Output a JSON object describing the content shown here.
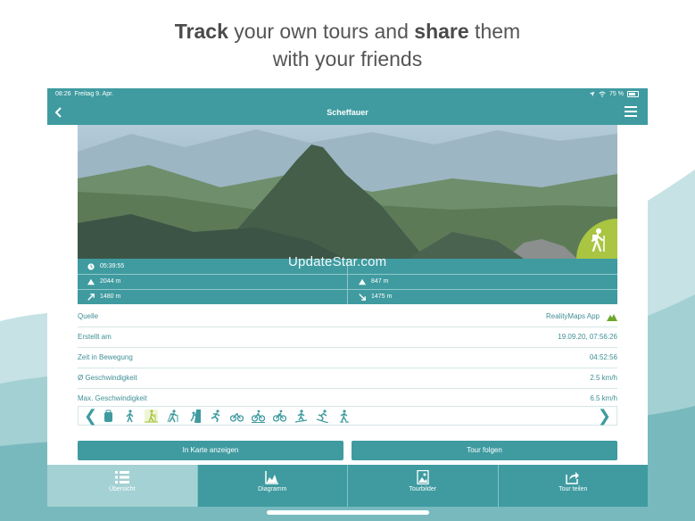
{
  "headline": {
    "part1": "Track",
    "part2": " your own tours and ",
    "part3": "share",
    "part4": " them",
    "part5": "with your friends"
  },
  "status_bar": {
    "time": "08:26",
    "date": "Freitag 9. Apr.",
    "battery": "75 %"
  },
  "nav": {
    "title": "Scheffauer",
    "back_icon": "chevron-left-icon",
    "menu_icon": "hamburger-menu-icon"
  },
  "photo": {
    "badge_icon": "hiker-icon"
  },
  "stats": {
    "row1": {
      "left": "05:39:55",
      "right": ""
    },
    "row2": {
      "left": "2044 m",
      "right": "847 m"
    },
    "row3": {
      "left": "1480 m",
      "right": "1475 m"
    }
  },
  "watermark": "UpdateStar.com",
  "info": [
    {
      "label": "Quelle",
      "value": "RealityMaps App"
    },
    {
      "label": "Erstellt am",
      "value": "19.09.20, 07:56:26"
    },
    {
      "label": "Zeit in Bewegung",
      "value": "04:52:56"
    },
    {
      "label": "Ø Geschwindigkeit",
      "value": "2.5 km/h"
    },
    {
      "label": "Max. Geschwindigkeit",
      "value": "6.5 km/h"
    }
  ],
  "activities": {
    "prev": "❮",
    "next": "❯",
    "icons": [
      "backpack-icon",
      "walking-icon",
      "hiking-icon",
      "nordic-walking-icon",
      "climbing-icon",
      "running-icon",
      "cycling-icon",
      "mountain-bike-icon",
      "ebike-icon",
      "ski-touring-icon",
      "skiing-icon",
      "snowshoe-icon"
    ]
  },
  "buttons": {
    "map": "In Karte anzeigen",
    "follow": "Tour folgen"
  },
  "tabs": [
    {
      "label": "Übersicht",
      "icon": "list-icon"
    },
    {
      "label": "Diagramm",
      "icon": "chart-icon"
    },
    {
      "label": "Tourbilder",
      "icon": "image-icon"
    },
    {
      "label": "Tour teilen",
      "icon": "share-icon"
    }
  ],
  "colors": {
    "primary": "#3f9ba0",
    "tab_active": "#a4d1d3",
    "badge": "#a9c542",
    "text_teal": "#3f8f94"
  }
}
